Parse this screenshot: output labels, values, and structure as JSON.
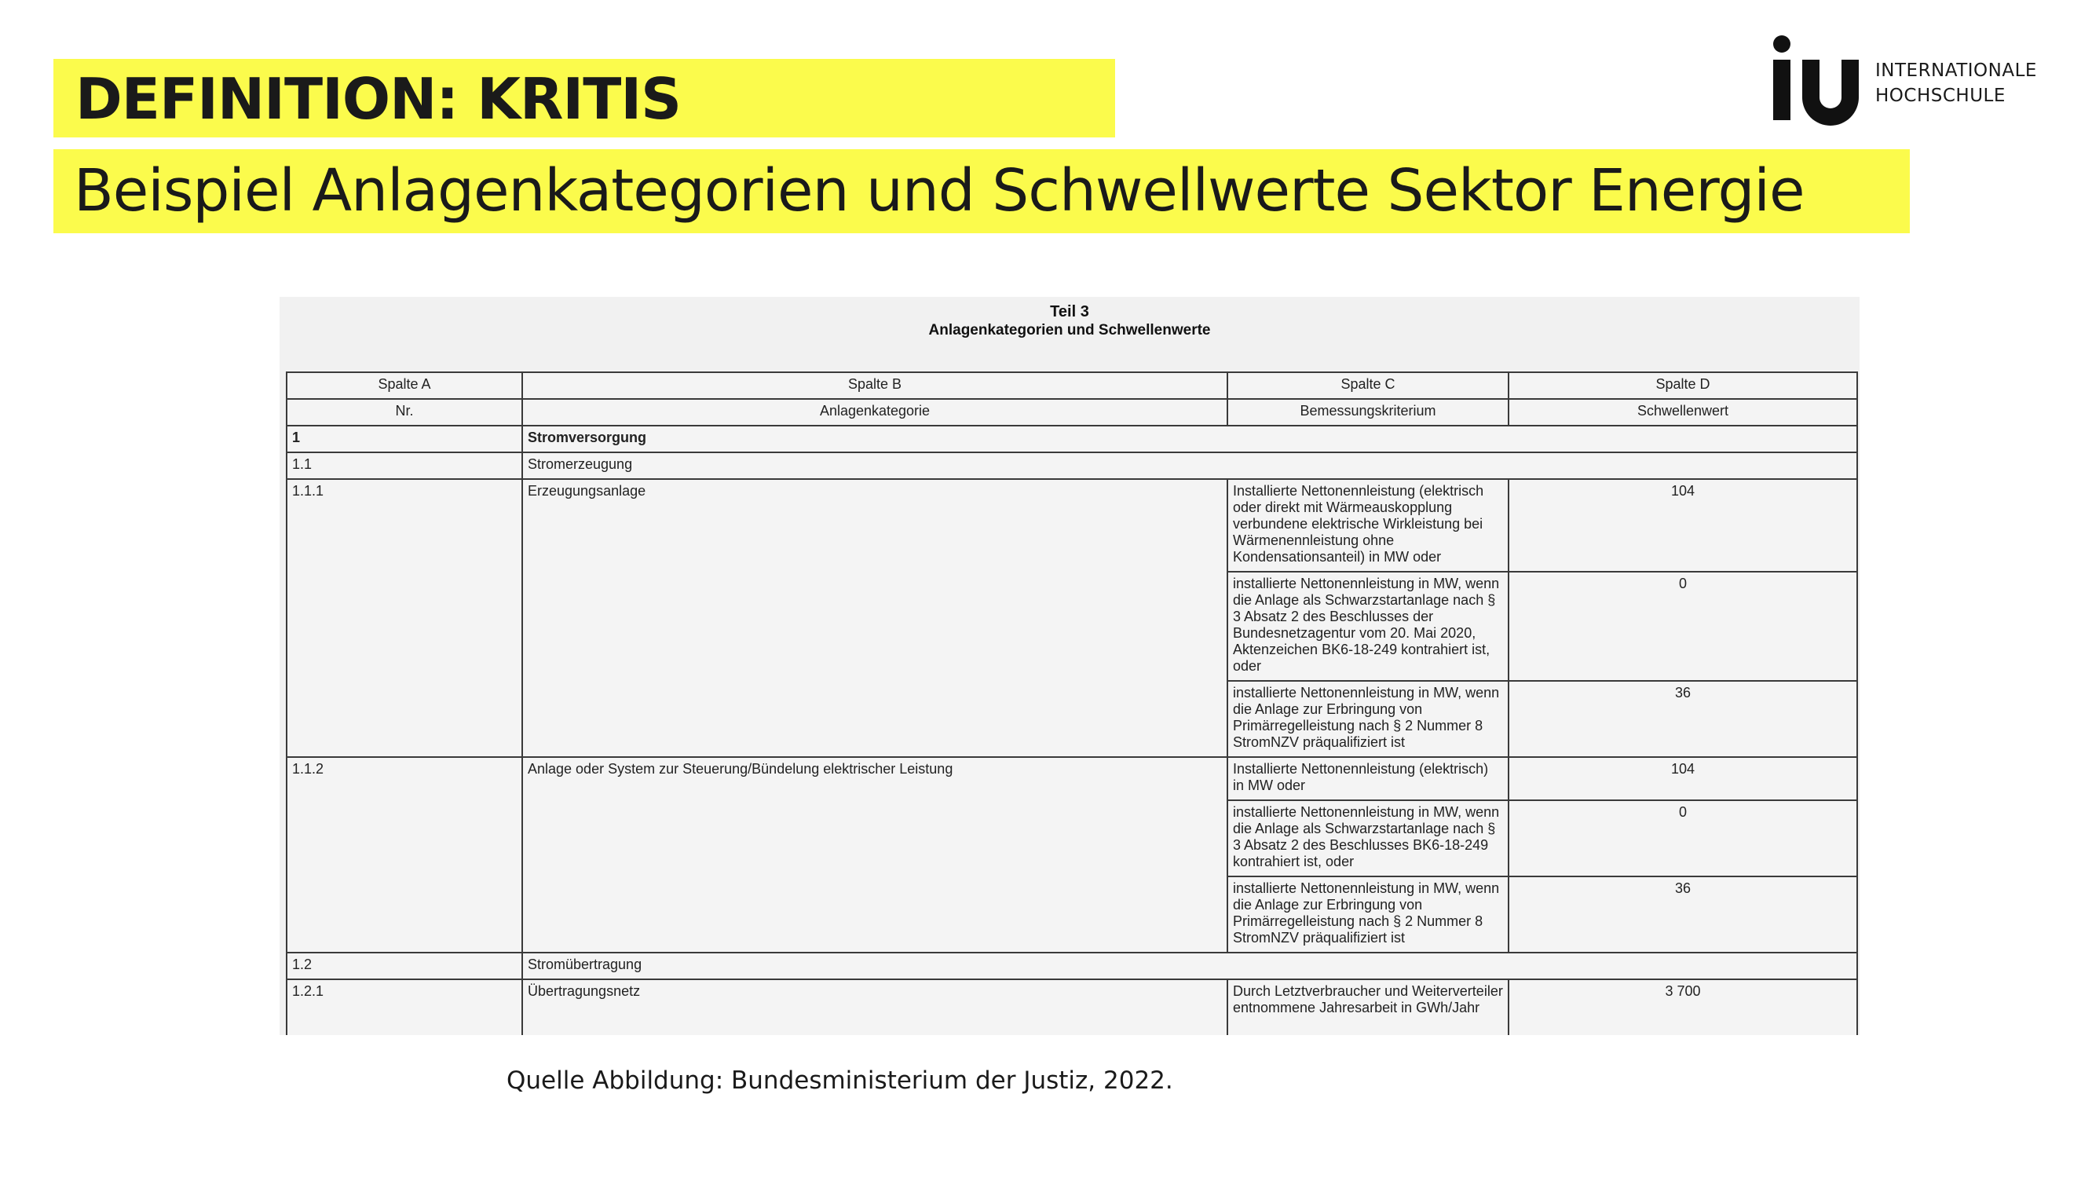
{
  "slide": {
    "title": "DEFINITION: KRITIS",
    "subtitle": "Beispiel Anlagenkategorien und Schwellwerte Sektor Energie",
    "caption": "Quelle Abbildung: Bundesministerium der Justiz, 2022.",
    "accent_color": "#fbfb4c"
  },
  "logo": {
    "mark": "iu",
    "line1": "INTERNATIONALE",
    "line2": "HOCHSCHULE"
  },
  "document": {
    "title": "Teil 3",
    "subtitle": "Anlagenkategorien und Schwellenwerte",
    "col_a": "Spalte A",
    "col_b": "Spalte B",
    "col_c": "Spalte C",
    "col_d": "Spalte D",
    "head_a": "Nr.",
    "head_b": "Anlagenkategorie",
    "head_c": "Bemessungskriterium",
    "head_d": "Schwellenwert",
    "r1_nr": "1",
    "r1_name": "Stromversorgung",
    "r11_nr": "1.1",
    "r11_name": "Stromerzeugung",
    "r111_nr": "1.1.1",
    "r111_name": "Erzeugungsanlage",
    "r111_c1": "Installierte Nettonennleistung (elektrisch oder direkt mit Wärmeauskopplung verbundene elektrische Wirkleistung bei Wärmenennleistung ohne Kondensationsanteil) in MW oder",
    "r111_d1": "104",
    "r111_c2": "installierte Nettonennleistung in MW, wenn die Anlage als Schwarzstartanlage nach § 3 Absatz 2 des Beschlusses der Bundesnetzagentur vom 20. Mai 2020, Aktenzeichen BK6-18-249 kontrahiert ist, oder",
    "r111_d2": "0",
    "r111_c3": "installierte Nettonennleistung in MW, wenn die Anlage zur Erbringung von Primärregelleistung nach § 2 Nummer 8 StromNZV präqualifiziert ist",
    "r111_d3": "36",
    "r112_nr": "1.1.2",
    "r112_name": "Anlage oder System zur Steuerung/Bündelung elektrischer Leistung",
    "r112_c1": "Installierte Nettonennleistung (elektrisch) in MW oder",
    "r112_d1": "104",
    "r112_c2": "installierte Nettonennleistung in MW, wenn die Anlage als Schwarzstartanlage nach § 3 Absatz 2 des Beschlusses BK6-18-249 kontrahiert ist, oder",
    "r112_d2": "0",
    "r112_c3": "installierte Nettonennleistung in MW, wenn die Anlage zur Erbringung von Primärregelleistung nach § 2 Nummer 8 StromNZV präqualifiziert ist",
    "r112_d3": "36",
    "r12_nr": "1.2",
    "r12_name": "Stromübertragung",
    "r121_nr": "1.2.1",
    "r121_name": "Übertragungsnetz",
    "r121_c1": "Durch Letztverbraucher und Weiterverteiler entnommene Jahresarbeit in GWh/Jahr",
    "r121_d1": "3 700"
  }
}
